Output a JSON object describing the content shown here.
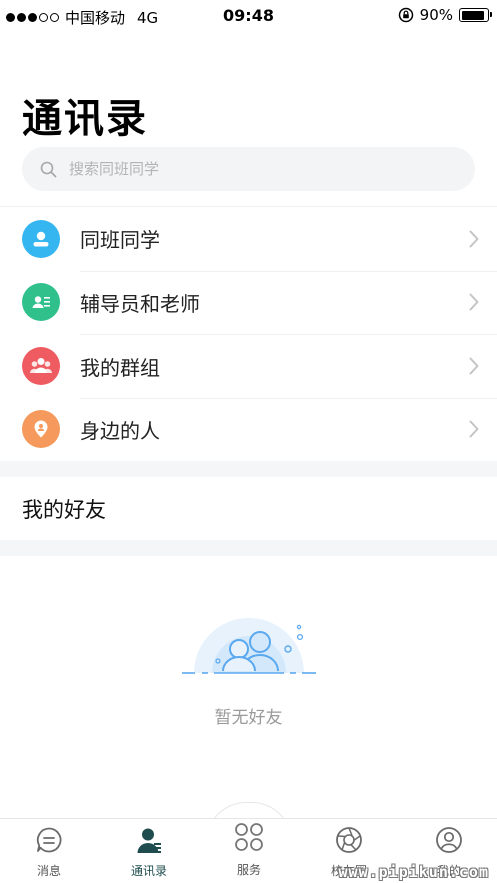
{
  "status_bar": {
    "carrier": "中国移动",
    "network": "4G",
    "time": "09:48",
    "battery": "90%",
    "battery_level": 0.9
  },
  "page_title": "通讯录",
  "search": {
    "placeholder": "搜索同班同学"
  },
  "contacts_menu": [
    {
      "label": "同班同学",
      "icon": "classmate-icon",
      "color": "#35b6f0"
    },
    {
      "label": "辅导员和老师",
      "icon": "teacher-card-icon",
      "color": "#2fc08c"
    },
    {
      "label": "我的群组",
      "icon": "group-icon",
      "color": "#ee5b60"
    },
    {
      "label": "身边的人",
      "icon": "location-person-icon",
      "color": "#f59a5c"
    }
  ],
  "friends_section": {
    "title": "我的好友",
    "empty_text": "暂无好友"
  },
  "tab_bar": [
    {
      "label": "消息",
      "icon": "message-icon",
      "active": false
    },
    {
      "label": "通讯录",
      "icon": "contacts-icon",
      "active": true
    },
    {
      "label": "服务",
      "icon": "service-icon",
      "active": false
    },
    {
      "label": "校友圈",
      "icon": "aperture-icon",
      "active": false
    },
    {
      "label": "我的",
      "icon": "profile-icon",
      "active": false
    }
  ],
  "watermark": "www.pipikun.com",
  "colors": {
    "accent": "#1f4d4f",
    "empty_illustration": "#5aa8ee"
  }
}
